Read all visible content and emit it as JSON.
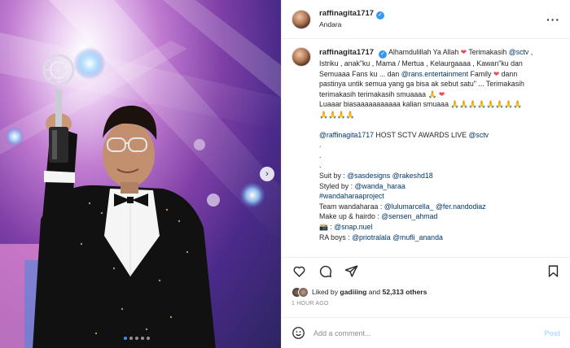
{
  "post": {
    "username": "raffinagita1717",
    "location": "Andara",
    "more_icon": "more-horizontal-icon"
  },
  "caption": {
    "username": "raffinagita1717",
    "lines": [
      {
        "parts": [
          {
            "t": "Alhamdulillah Ya Allah ",
            "k": "text"
          },
          {
            "t": "❤",
            "k": "heart"
          },
          {
            "t": " Terimakasih ",
            "k": "text"
          },
          {
            "t": "@sctv",
            "k": "mention"
          },
          {
            "t": " ,",
            "k": "text"
          }
        ]
      },
      {
        "parts": [
          {
            "t": "Istriku , anak\"ku , Mama / Mertua , Kelaurgaaaa , Kawan\"ku dan",
            "k": "text"
          }
        ]
      },
      {
        "parts": [
          {
            "t": "Semuaaa Fans ku ... dan ",
            "k": "text"
          },
          {
            "t": "@rans.entertainment",
            "k": "mention"
          },
          {
            "t": " Family ",
            "k": "text"
          },
          {
            "t": "❤",
            "k": "heart"
          },
          {
            "t": " dann",
            "k": "text"
          }
        ]
      },
      {
        "parts": [
          {
            "t": "pastinya untik semua yang ga bisa ak sebut satu\" ... Terimakasih",
            "k": "text"
          }
        ]
      },
      {
        "parts": [
          {
            "t": "terimakasih terimakasih smuaaaa 🙏 ",
            "k": "text"
          },
          {
            "t": "❤",
            "k": "heart"
          }
        ]
      },
      {
        "parts": [
          {
            "t": "Luaaar biasaaaaaaaaaaa kalian smuaaa 🙏🙏🙏🙏🙏🙏🙏🙏",
            "k": "text"
          }
        ]
      },
      {
        "parts": [
          {
            "t": "🙏🙏🙏🙏",
            "k": "text"
          }
        ]
      },
      {
        "parts": [
          {
            "t": "",
            "k": "text"
          }
        ]
      },
      {
        "parts": [
          {
            "t": "@raffinagita1717",
            "k": "mention"
          },
          {
            "t": " HOST SCTV AWARDS LIVE ",
            "k": "text"
          },
          {
            "t": "@sctv",
            "k": "mention"
          }
        ]
      },
      {
        "parts": [
          {
            "t": ".",
            "k": "text"
          }
        ]
      },
      {
        "parts": [
          {
            "t": ".",
            "k": "text"
          }
        ]
      },
      {
        "parts": [
          {
            "t": ".",
            "k": "text"
          }
        ]
      },
      {
        "parts": [
          {
            "t": "Suit by : ",
            "k": "text"
          },
          {
            "t": "@sasdesigns",
            "k": "mention"
          },
          {
            "t": " ",
            "k": "text"
          },
          {
            "t": "@rakeshd18",
            "k": "mention"
          }
        ]
      },
      {
        "parts": [
          {
            "t": "Styled by : ",
            "k": "text"
          },
          {
            "t": "@wanda_haraa",
            "k": "mention"
          }
        ]
      },
      {
        "parts": [
          {
            "t": "#wandaharaaproject",
            "k": "mention"
          }
        ]
      },
      {
        "parts": [
          {
            "t": "Team wandaharaa : ",
            "k": "text"
          },
          {
            "t": "@lulumarcella_",
            "k": "mention"
          },
          {
            "t": " ",
            "k": "text"
          },
          {
            "t": "@fer.nandodiaz",
            "k": "mention"
          }
        ]
      },
      {
        "parts": [
          {
            "t": "Make up & hairdo : ",
            "k": "text"
          },
          {
            "t": "@sensen_ahmad",
            "k": "mention"
          }
        ]
      },
      {
        "parts": [
          {
            "t": "📸 : ",
            "k": "text"
          },
          {
            "t": "@snap.nuel",
            "k": "mention"
          }
        ]
      },
      {
        "parts": [
          {
            "t": "RA boys : ",
            "k": "text"
          },
          {
            "t": "@priotralala",
            "k": "mention"
          },
          {
            "t": " ",
            "k": "text"
          },
          {
            "t": "@mufli_ananda",
            "k": "mention"
          }
        ]
      }
    ]
  },
  "actions": {
    "like_icon": "heart-icon",
    "comment_icon": "comment-icon",
    "share_icon": "share-icon",
    "save_icon": "bookmark-icon"
  },
  "likes": {
    "prefix": "Liked by ",
    "user": "gadiiing",
    "middle": " and ",
    "count": "52,313 others"
  },
  "timestamp": "1 HOUR AGO",
  "comment_box": {
    "placeholder": "Add a comment...",
    "post_label": "Post",
    "emoji_icon": "smiley-icon"
  },
  "carousel": {
    "next_icon": "chevron-right-icon",
    "dots": 5,
    "active_dot": 0
  }
}
